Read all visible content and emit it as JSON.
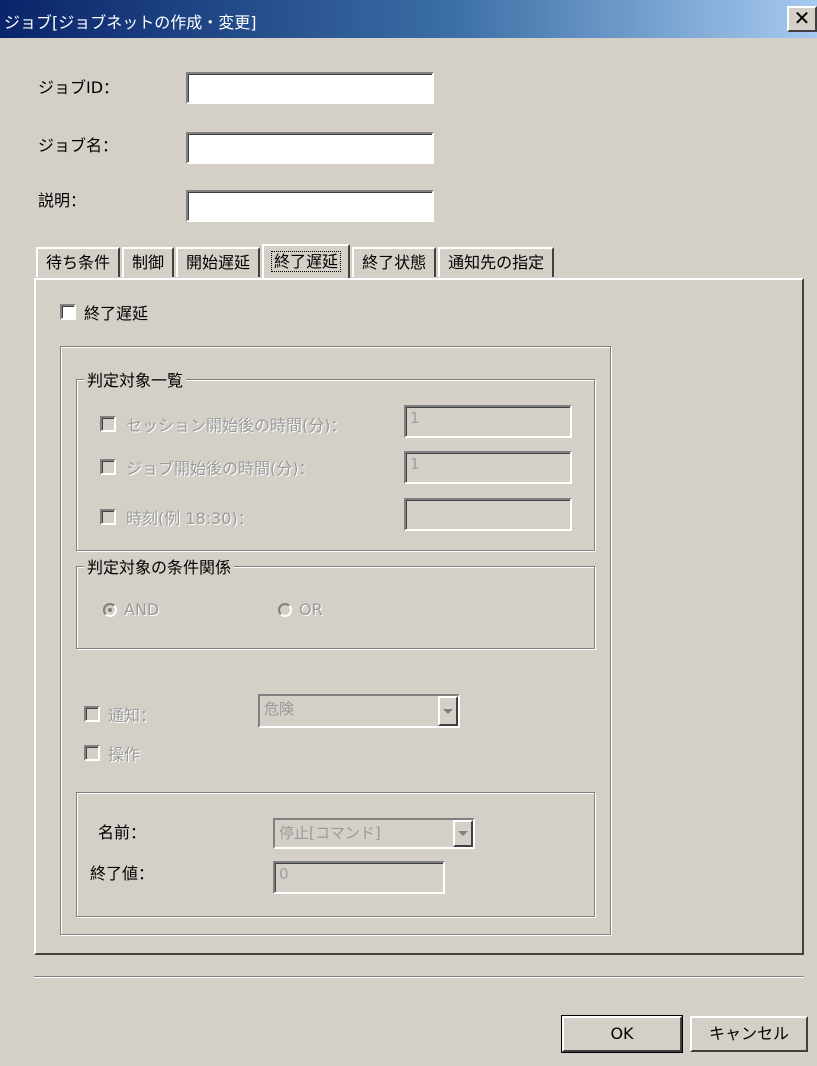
{
  "window": {
    "title": "ジョブ[ジョブネットの作成・変更]",
    "close_glyph": "✕"
  },
  "form": {
    "job_id_label": "ジョブID：",
    "job_id_value": "",
    "job_name_label": "ジョブ名：",
    "job_name_value": "",
    "description_label": "説明：",
    "description_value": ""
  },
  "tabs": [
    "待ち条件",
    "制御",
    "開始遅延",
    "終了遅延",
    "終了状態",
    "通知先の指定"
  ],
  "active_tab": "終了遅延",
  "panel": {
    "end_delay_label": "終了遅延",
    "judgment_group": {
      "title": "判定対象一覧",
      "items": [
        {
          "label": "セッション開始後の時間(分)：",
          "value": "1"
        },
        {
          "label": "ジョブ開始後の時間(分)：",
          "value": "1"
        },
        {
          "label": "時刻(例 18:30)：",
          "value": ""
        }
      ]
    },
    "condition_group": {
      "title": "判定対象の条件関係",
      "and_label": "AND",
      "or_label": "OR",
      "selected": "AND"
    },
    "notify_label": "通知：",
    "notify_value": "危険",
    "operation_label": "操作",
    "operation_group": {
      "name_label": "名前：",
      "name_value": "停止[コマンド]",
      "exit_value_label": "終了値：",
      "exit_value": "0"
    }
  },
  "buttons": {
    "ok": "OK",
    "cancel": "キャンセル"
  }
}
